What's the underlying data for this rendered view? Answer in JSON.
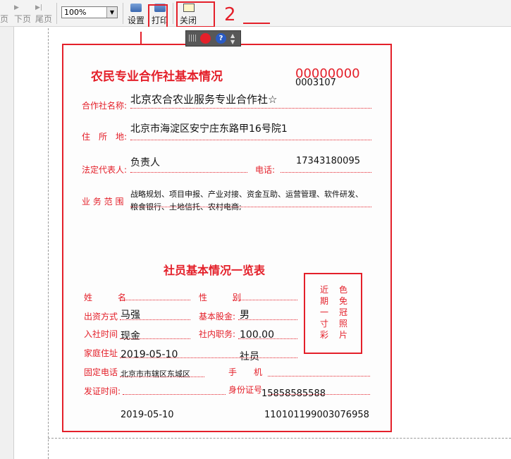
{
  "toolbar": {
    "prev_page": "页",
    "next_page": "下页",
    "last_page": "尾页",
    "zoom_value": "100%",
    "setup_label": "设置",
    "print_label": "打印",
    "close_label": "关闭"
  },
  "annotations": {
    "two": "2"
  },
  "card": {
    "title": "农民专业合作社基本情况",
    "code_red": "00000000",
    "code_black": "0003107",
    "fields": {
      "name_label": "合作社名称:",
      "name_value": "北京农合农业服务专业合作社☆",
      "address_label": "住　所　地:",
      "address_value": "北京市海淀区安宁庄东路甲16号院1",
      "rep_label": "法定代表人:",
      "rep_value": "负责人",
      "phone_label": "电话:",
      "phone_value": "17343180095",
      "scope_label": "业 务 范 围",
      "scope_line1": "战略规划、项目申报、产业对接、资金互助、运营管理、软件研发、",
      "scope_line2": "粮食银行、土地信托、农村电商;"
    },
    "member_title": "社员基本情况一览表",
    "member": {
      "name_label": "姓　　　名",
      "gender_label": "性　　　别",
      "funding_label": "出资方式",
      "funding_value": "马强",
      "share_label": "基本股金:",
      "share_value": "男",
      "join_label": "入社时间",
      "join_value": "现金",
      "position_label": "社内职务:",
      "position_value": "100.00",
      "home_label": "家庭住址",
      "home_value": "2019-05-10",
      "member_value": "社员",
      "fixed_phone_label": "固定电话",
      "fixed_phone_value": "北京市市辖区东城区",
      "mobile_label": "手　　机",
      "issue_label": "发证时间:",
      "id_label": "身份证号",
      "id_phone_value": "15858585588",
      "issue_value": "2019-05-10",
      "id_value": "110101199003076958"
    },
    "photo": {
      "col1": "近期一寸彩",
      "col2": "色免冠照片"
    }
  }
}
